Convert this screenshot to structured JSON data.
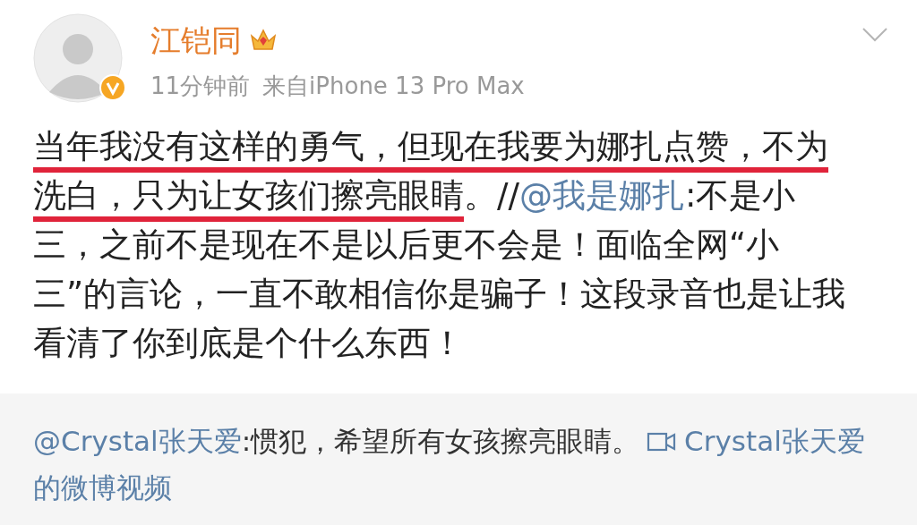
{
  "post": {
    "author": "江铠同",
    "verified": true,
    "time": "11分钟前",
    "source": "来自iPhone 13 Pro Max",
    "text_parts": [
      {
        "kind": "text",
        "underlined": true,
        "text": "当年我没有这样的勇气，但现在我要为娜扎点赞，不为洗白，只为让女孩们擦亮眼睛"
      },
      {
        "kind": "text",
        "underlined": false,
        "text": "。//"
      },
      {
        "kind": "mention",
        "text": "@我是娜扎"
      },
      {
        "kind": "text",
        "underlined": false,
        "text": ":不是小三，之前不是现在不是以后更不会是！面临全网“小三”的言论，一直不敢相信你是骗子！这段录音也是让我看清了你到底是个什么东西！"
      }
    ]
  },
  "repost": {
    "parts": [
      {
        "kind": "mention",
        "text": "@Crystal张天爱"
      },
      {
        "kind": "text",
        "text": ":惯犯，希望所有女孩擦亮眼睛。"
      },
      {
        "kind": "video",
        "text": "Crystal张天爱的微博视频"
      }
    ]
  }
}
